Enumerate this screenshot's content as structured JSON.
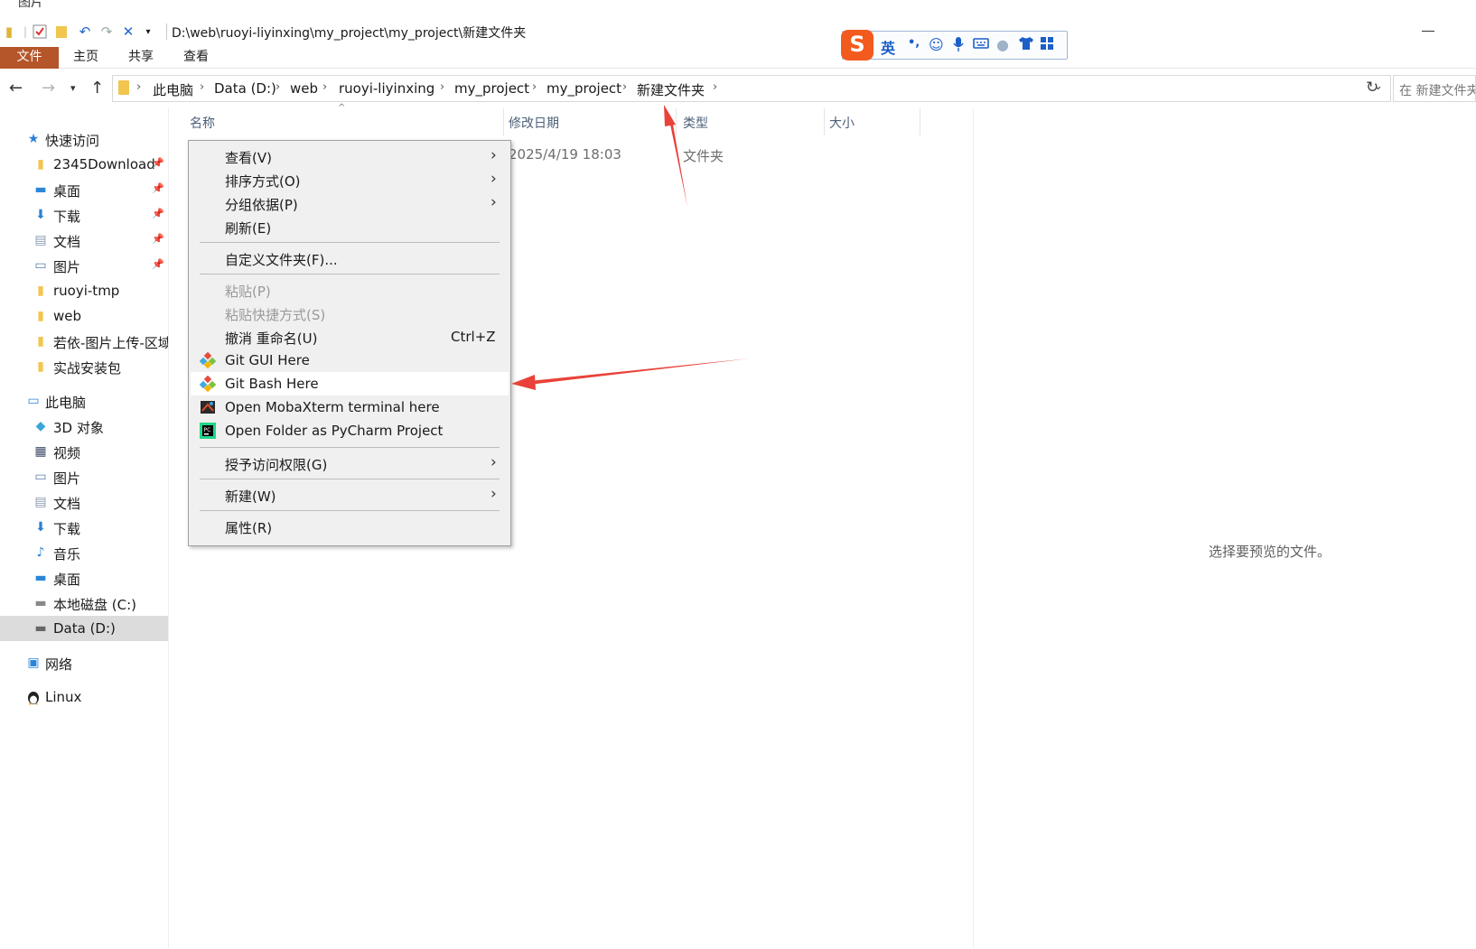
{
  "window": {
    "title_path": "D:\\web\\ruoyi-liyinxing\\my_project\\my_project\\新建文件夹",
    "top_cut_text": "图片"
  },
  "ribbon": {
    "tabs": [
      "文件",
      "主页",
      "共享",
      "查看"
    ]
  },
  "ime": {
    "logo": "S",
    "mode": "英",
    "punct": "•,"
  },
  "address": {
    "crumbs": [
      "此电脑",
      "Data (D:)",
      "web",
      "ruoyi-liyinxing",
      "my_project",
      "my_project",
      "新建文件夹"
    ],
    "search_placeholder": "在 新建文件夹"
  },
  "nav": {
    "quick_access": "快速访问",
    "items_quick": [
      "2345Download",
      "桌面",
      "下载",
      "文档",
      "图片",
      "ruoyi-tmp",
      "web",
      "若依-图片上传-区域",
      "实战安装包"
    ],
    "this_pc": "此电脑",
    "items_pc": [
      "3D 对象",
      "视频",
      "图片",
      "文档",
      "下载",
      "音乐",
      "桌面",
      "本地磁盘 (C:)",
      "Data (D:)"
    ],
    "network": "网络",
    "linux": "Linux"
  },
  "columns": {
    "name": "名称",
    "modified": "修改日期",
    "type": "类型",
    "size": "大小"
  },
  "row": {
    "modified": "2025/4/19 18:03",
    "type": "文件夹"
  },
  "preview": {
    "empty_text": "选择要预览的文件。"
  },
  "context_menu": {
    "view": "查看(V)",
    "sort": "排序方式(O)",
    "group": "分组依据(P)",
    "refresh": "刷新(E)",
    "customize": "自定义文件夹(F)...",
    "paste": "粘贴(P)",
    "paste_shortcut": "粘贴快捷方式(S)",
    "undo": "撤消 重命名(U)",
    "undo_shortcut": "Ctrl+Z",
    "git_gui": "Git GUI Here",
    "git_bash": "Git Bash Here",
    "moba": "Open MobaXterm terminal here",
    "pycharm": "Open Folder as PyCharm Project",
    "access": "授予访问权限(G)",
    "new": "新建(W)",
    "properties": "属性(R)"
  },
  "colors": {
    "file_tab": "#b4562a",
    "annotation_arrow": "#e8423a",
    "ime_logo": "#f35a1e"
  }
}
